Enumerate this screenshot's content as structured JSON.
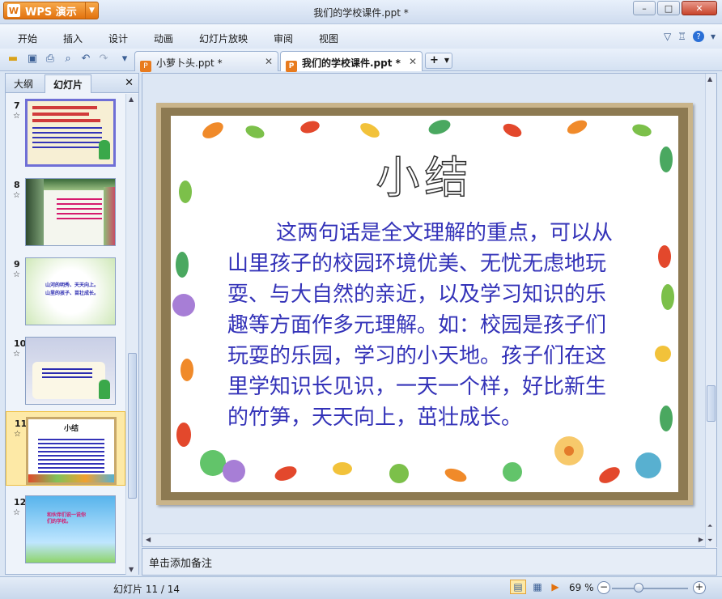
{
  "window": {
    "app_name": "WPS 演示",
    "app_logo": "W",
    "title": "我们的学校课件.ppt *",
    "minimize": "–",
    "maximize": "□",
    "close": "✕"
  },
  "menu": {
    "items": [
      "开始",
      "插入",
      "设计",
      "动画",
      "幻灯片放映",
      "审阅",
      "视图"
    ],
    "help": "?"
  },
  "tabs": [
    {
      "label": "小萝卜头.ppt *",
      "active": false
    },
    {
      "label": "我们的学校课件.ppt *",
      "active": true
    }
  ],
  "left_pane": {
    "tabs": [
      "大纲",
      "幻灯片"
    ],
    "active_tab": "幻灯片",
    "thumbnails": [
      {
        "number": "7"
      },
      {
        "number": "8"
      },
      {
        "number": "9",
        "lines": [
          "山河的明秀、天天向上。",
          "山里的孩子、苗壮成长。"
        ]
      },
      {
        "number": "10"
      },
      {
        "number": "11",
        "title": "小结",
        "selected": true
      },
      {
        "number": "12",
        "lines": [
          "和伙伴们说一说你",
          "们的学校。"
        ]
      }
    ]
  },
  "slide": {
    "title": "小结",
    "body": "这两句话是全文理解的重点，可以从山里孩子的校园环境优美、无忧无虑地玩耍、与大自然的亲近，以及学习知识的乐趣等方面作多元理解。如：校园是孩子们玩耍的乐园，学习的小天地。孩子们在这里学知识长见识，一天一个样，好比新生的竹笋，天天向上，茁壮成长。"
  },
  "notes": {
    "placeholder": "单击添加备注"
  },
  "status": {
    "slide_counter": "幻灯片 11 / 14",
    "zoom": "69 %",
    "zoom_level": 0.69
  },
  "colors": {
    "body_text": "#3332b8",
    "app_button": "#e2720e",
    "selected_thumb": "#fde9a6"
  }
}
